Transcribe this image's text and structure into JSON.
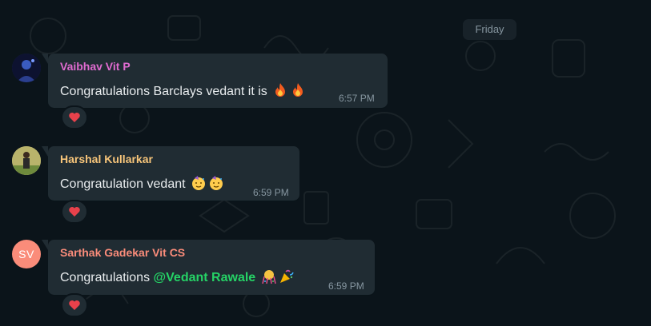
{
  "date_separator": "Friday",
  "messages": [
    {
      "sender": "Vaibhav Vit P",
      "sender_color": "#e06bd0",
      "text": "Congratulations Barclays vedant it is",
      "emojis": [
        "fire",
        "fire"
      ],
      "time": "6:57 PM",
      "reaction": "red-heart"
    },
    {
      "sender": "Harshal Kullarkar",
      "sender_color": "#f7c57a",
      "text": "Congratulation vedant",
      "emojis": [
        "partying-face",
        "partying-face"
      ],
      "time": "6:59 PM",
      "reaction": "red-heart"
    },
    {
      "sender": "Sarthak Gadekar Vit CS",
      "sender_color": "#fa8c7a",
      "avatar_initials": "SV",
      "text": "Congratulations",
      "mention": "@Vedant Rawale",
      "emojis": [
        "confetti-ball",
        "party-popper"
      ],
      "time": "6:59 PM",
      "reaction": "red-heart"
    }
  ],
  "colors": {
    "background": "#0b141a",
    "bubble": "#202c33",
    "timestamp": "#8696a0",
    "mention": "#25d366"
  }
}
